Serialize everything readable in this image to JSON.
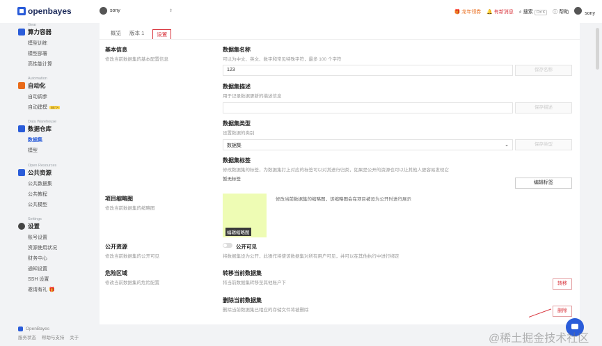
{
  "topbar": {
    "brand": "openbayes",
    "user": "sony",
    "promo": "龙年领券",
    "news": "有新消息",
    "search": "搜索",
    "search_kbd": "Ctrl K",
    "help": "帮助",
    "account": "sony"
  },
  "sidebar": {
    "sections": [
      {
        "en": "Gear",
        "title": "算力容器",
        "color": "#2a5cd9",
        "items": [
          "模型训练",
          "模型部署",
          "高性能计算"
        ]
      },
      {
        "en": "Automation",
        "title": "自动化",
        "color": "#e96b1a",
        "items": [
          "自动调参",
          "自动建模"
        ],
        "beta": "BETA"
      },
      {
        "en": "Data Warehouse",
        "title": "数据仓库",
        "color": "#2a5cd9",
        "items": [
          "数据集",
          "模型"
        ],
        "active": "数据集"
      },
      {
        "en": "Open Resources",
        "title": "公共资源",
        "color": "#2a5cd9",
        "items": [
          "公共数据集",
          "公共教程",
          "公共模型"
        ]
      },
      {
        "en": "Settings",
        "title": "设置",
        "color": "#444",
        "items": [
          "账号设置",
          "资源使用状况",
          "财务中心",
          "通知设置",
          "SSH 设置",
          "邀请有礼"
        ]
      }
    ],
    "footer": {
      "brand": "OpenBayes",
      "links": [
        "服务状态",
        "帮助与支持",
        "关于"
      ]
    }
  },
  "tabs": [
    "概览",
    "版本 1",
    "设置"
  ],
  "basic": {
    "title": "基本信息",
    "desc": "修改当前数据集的基本配置信息",
    "name_title": "数据集名称",
    "name_desc": "可以为中文、英文、数字和常见特殊字符，最多 100 个字符",
    "name_value": "123",
    "save_name": "保存名称",
    "desc_title": "数据集描述",
    "desc_desc": "用于记录数据更新的描述信息",
    "desc_value": "",
    "save_desc": "保存描述",
    "type_title": "数据集类型",
    "type_desc": "设置数据的类别",
    "type_value": "数据集",
    "save_type": "保存类型",
    "tags_title": "数据集标签",
    "tags_desc": "修改数据集的标签，为数据集打上对应的标签可以对其进行归类，如果是公开的资源也可以让其他人更容易发现它",
    "tags_empty": "暂无标签",
    "edit_tags": "编辑标签"
  },
  "thumbnail": {
    "title": "项目缩略图",
    "desc": "修改当前数据集的缩略图",
    "info": "修改当前数据集的缩略图，该缩略图会在项目被设为公开时进行展示",
    "edit": "编辑缩略图"
  },
  "public": {
    "title": "公开资源",
    "desc": "修改当前数据集的公开可见",
    "toggle_label": "公开可见",
    "info": "将数据集设为公开，此操作将使该数据集对所有用户可见，并可以在其他执行中进行绑定"
  },
  "danger": {
    "title": "危险区域",
    "desc": "修改当前数据集的危险配置",
    "transfer_title": "转移当前数据集",
    "transfer_desc": "将当前数据集转移至其他账户下",
    "transfer_btn": "转移",
    "delete_title": "删除当前数据集",
    "delete_desc": "删除当前数据集已相应的存储文件将被删除",
    "delete_btn": "删除"
  },
  "watermark": "@稀土掘金技术社区"
}
